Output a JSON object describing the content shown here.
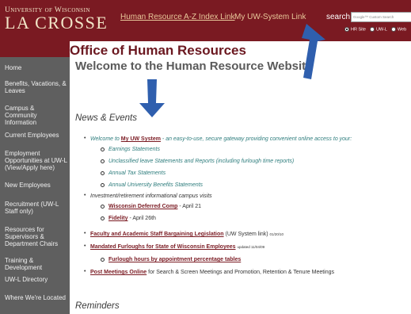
{
  "header": {
    "logo_top": "University of Wisconsin",
    "logo_main": "LA CROSSE",
    "hr_link": "Human Resource A-Z Index Link",
    "uw_link": "My UW-System Link",
    "search_label": "search",
    "search_placeholder": "Google™ Custom Search",
    "radio_options": [
      "HR Site",
      "UW-L",
      "Web"
    ]
  },
  "office_title": "Office of Human Resources",
  "sidebar": {
    "items": [
      "Home",
      "Benefits, Vacations, & Leaves",
      "Campus & Community Information",
      "Current Employees",
      "Employment Opportunities at UW-L (View/Apply here)",
      "New Employees",
      "Recruitment (UW-L Staff only)",
      "Resources for Supervisors & Department Chairs",
      "Training & Development",
      "UW-L Directory",
      "Where We're Located"
    ]
  },
  "main": {
    "welcome": "Welcome to the Human Resource Website",
    "news_heading": "News & Events",
    "reminders_heading": "Reminders",
    "welcome_line": {
      "pre": "Welcome to ",
      "link": "My UW System",
      "post": " - an easy-to-use, secure gateway providing convenient online access to your:"
    },
    "sub_items": [
      "Earnings Statements",
      "Unclassified leave Statements and Reports (including furlough time reports)",
      "Annual Tax Statements",
      "Annual University Benefits Statements"
    ],
    "visits": "Investment/retirement informational campus visits",
    "visit_items": [
      {
        "link": "Wisconsin Deferred Comp",
        "date": " - April 21"
      },
      {
        "link": "Fidelity",
        "date": " - April 26th"
      }
    ],
    "bargaining": {
      "link": "Faculty and Academic Staff Bargaining Legislation",
      "note": "(UW System link)",
      "date": "01/20/10"
    },
    "furloughs": {
      "link": "Mandated Furloughs for State of Wisconsin Employees",
      "note": "updated 11/04/09"
    },
    "furlough_hours": "Furlough hours by appointment percentage tables",
    "post_meetings": {
      "link": "Post Meetings Online",
      "rest": " for Search & Screen Meetings and Promotion, Retention & Tenure Meetings"
    }
  },
  "colors": {
    "maroon": "#7a1a22",
    "sidebar": "#5f5f5f",
    "teal": "#2e7d7d",
    "arrow": "#2f5fae"
  }
}
